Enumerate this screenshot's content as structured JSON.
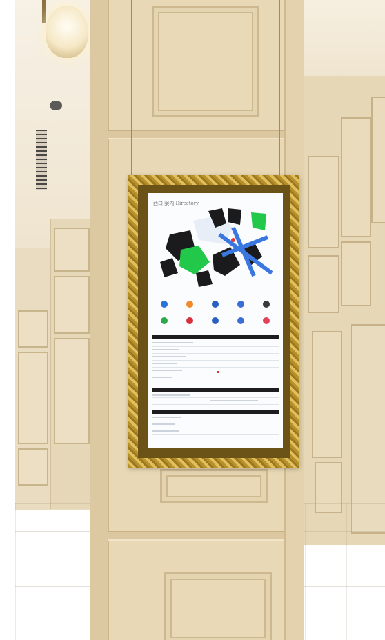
{
  "screen": {
    "logo_text": "西口 案内 Directory",
    "shortcut_colors_row1": [
      "#2a74d9",
      "#f08a2a",
      "#2a5fbf",
      "#3a6ed6",
      "#3a3a3a"
    ],
    "shortcut_colors_row2": [
      "#2aa84a",
      "#d9303a",
      "#2a5fbf",
      "#3a6ed6",
      "#e3405a"
    ],
    "sections": [
      {
        "rows": 7
      },
      {
        "rows": 3
      },
      {
        "rows": 4
      }
    ],
    "map_colors": {
      "building": "#1b1b1d",
      "green_zone": "#22c84a",
      "water": "#3a78e0",
      "light_zone": "#e8eef8"
    }
  }
}
